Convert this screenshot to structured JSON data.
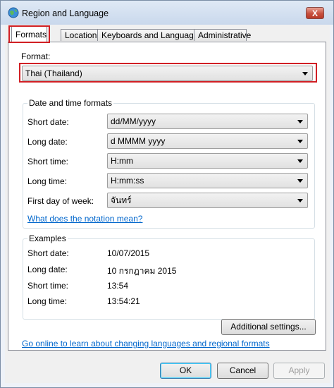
{
  "window": {
    "title": "Region and Language",
    "close_label": "X"
  },
  "tabs": [
    {
      "label": "Formats",
      "active": true
    },
    {
      "label": "Location",
      "active": false
    },
    {
      "label": "Keyboards and Languages",
      "active": false
    },
    {
      "label": "Administrative",
      "active": false
    }
  ],
  "format": {
    "label": "Format:",
    "value": "Thai (Thailand)"
  },
  "date_time_formats": {
    "title": "Date and time formats",
    "rows": [
      {
        "label": "Short date:",
        "value": "dd/MM/yyyy"
      },
      {
        "label": "Long date:",
        "value": "d MMMM yyyy"
      },
      {
        "label": "Short time:",
        "value": "H:mm"
      },
      {
        "label": "Long time:",
        "value": "H:mm:ss"
      },
      {
        "label": "First day of week:",
        "value": "จันทร์"
      }
    ],
    "notation_link": "What does the notation mean?"
  },
  "examples": {
    "title": "Examples",
    "rows": [
      {
        "label": "Short date:",
        "value": "10/07/2015"
      },
      {
        "label": "Long date:",
        "value": "10 กรกฎาคม 2015"
      },
      {
        "label": "Short time:",
        "value": "13:54"
      },
      {
        "label": "Long time:",
        "value": "13:54:21"
      }
    ]
  },
  "additional_settings_label": "Additional settings...",
  "online_link": "Go online to learn about changing languages and regional formats",
  "buttons": {
    "ok": "OK",
    "cancel": "Cancel",
    "apply": "Apply"
  }
}
